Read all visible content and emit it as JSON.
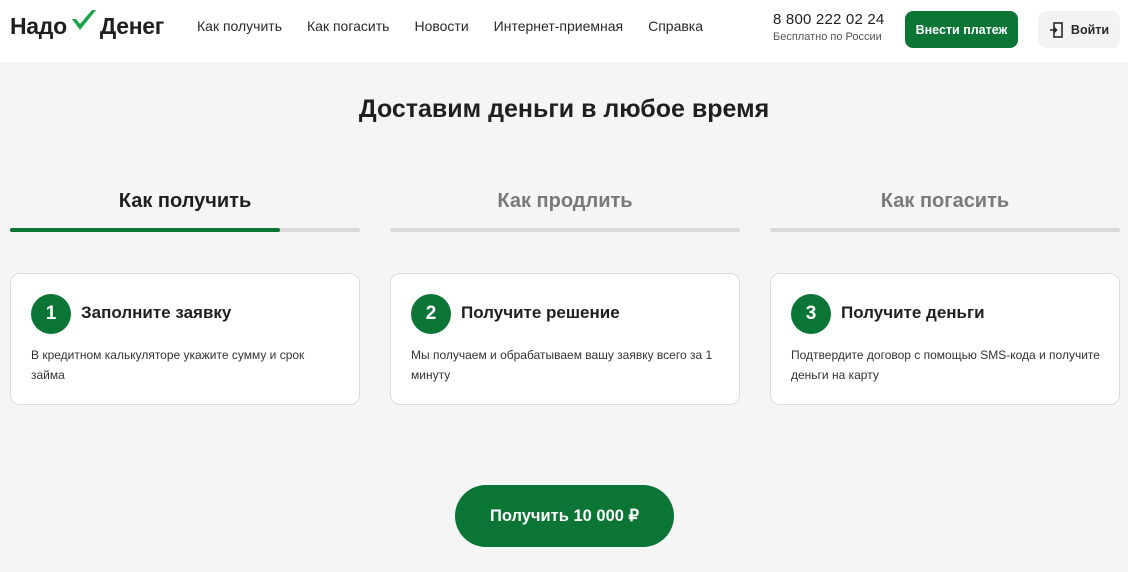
{
  "header": {
    "logo_left": "Надо",
    "logo_right": "Денег",
    "nav": [
      "Как получить",
      "Как погасить",
      "Новости",
      "Интернет-приемная",
      "Справка"
    ],
    "phone": "8 800 222 02 24",
    "phone_note": "Бесплатно по России",
    "pay_button": "Внести платеж",
    "login_button": "Войти"
  },
  "title": "Доставим деньги в любое время",
  "tabs": [
    {
      "label": "Как получить",
      "active": true,
      "progress": 0.77
    },
    {
      "label": "Как продлить",
      "active": false,
      "progress": 0
    },
    {
      "label": "Как погасить",
      "active": false,
      "progress": 0
    }
  ],
  "steps": [
    {
      "number": "1",
      "title": "Заполните заявку",
      "text": "В кредитном калькуляторе укажите сумму и срок займа"
    },
    {
      "number": "2",
      "title": "Получите решение",
      "text": "Мы получаем и обрабатываем вашу заявку всего за 1 минуту"
    },
    {
      "number": "3",
      "title": "Получите деньги",
      "text": "Подтвердите договор с помощью SMS-кода и получите деньги на карту"
    }
  ],
  "cta": "Получить 10 000 ₽",
  "colors": {
    "accent": "#0b7535",
    "track": "#d9d9d9",
    "background": "#f5f5f5"
  },
  "icons": {
    "logo_mark": "check-icon",
    "login": "door-exit-icon"
  }
}
